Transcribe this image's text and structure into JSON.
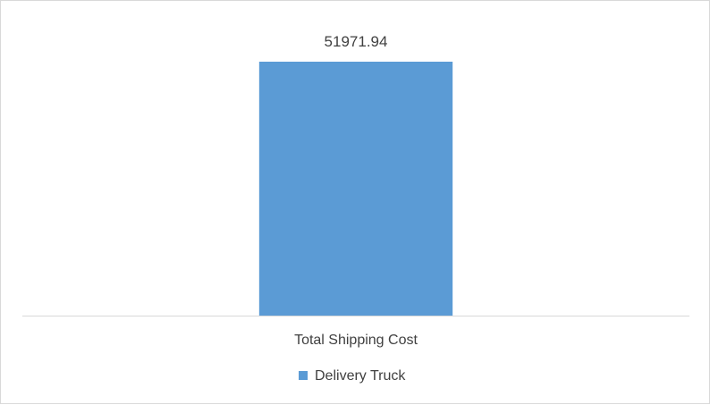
{
  "chart_data": {
    "type": "bar",
    "categories": [
      "Total Shipping Cost"
    ],
    "series": [
      {
        "name": "Delivery Truck",
        "values": [
          51971.94
        ],
        "data_labels": [
          "51971.94"
        ],
        "color": "#5b9bd5"
      }
    ],
    "title": "",
    "xlabel": "",
    "ylabel": "",
    "ylim": [
      0,
      51971.94
    ],
    "grid": false,
    "legend_position": "bottom",
    "axis_color": "#d9d9d9",
    "text_color": "#404040"
  }
}
